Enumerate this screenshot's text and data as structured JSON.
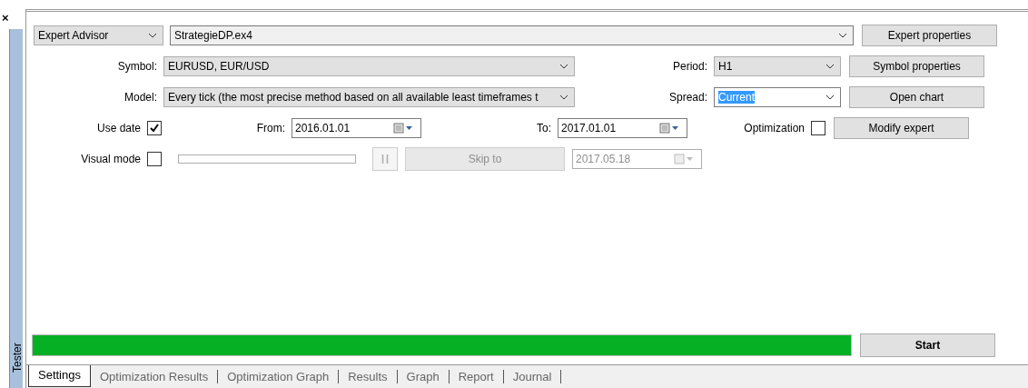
{
  "close": "×",
  "side_label": "Tester",
  "expert": {
    "type": "Expert Advisor",
    "file": "StrategieDP.ex4"
  },
  "symbol": {
    "label": "Symbol:",
    "value": "EURUSD, EUR/USD"
  },
  "period": {
    "label": "Period:",
    "value": "H1"
  },
  "model": {
    "label": "Model:",
    "value": "Every tick (the most precise method based on all available least timeframes t"
  },
  "spread": {
    "label": "Spread:",
    "value": "Current",
    "selected": true
  },
  "use_date": {
    "label": "Use date",
    "checked": true
  },
  "from": {
    "label": "From:",
    "value": "2016.01.01"
  },
  "to": {
    "label": "To:",
    "value": "2017.01.01"
  },
  "optimization": {
    "label": "Optimization",
    "checked": false
  },
  "visual_mode": {
    "label": "Visual mode",
    "checked": false
  },
  "pause": {
    "disabled": true
  },
  "skip_to": {
    "label": "Skip to",
    "disabled": true
  },
  "skip_date": {
    "value": "2017.05.18",
    "disabled": true
  },
  "buttons": [
    "Expert properties",
    "Symbol properties",
    "Open chart",
    "Modify expert"
  ],
  "progress": {
    "level": 1
  },
  "start": "Start",
  "tabs": [
    {
      "label": "Settings",
      "selected": true
    },
    {
      "label": "Optimization Results",
      "selected": false
    },
    {
      "label": "Optimization Graph",
      "selected": false
    },
    {
      "label": "Results",
      "selected": false
    },
    {
      "label": "Graph",
      "selected": false
    },
    {
      "label": "Report",
      "selected": false
    },
    {
      "label": "Journal",
      "selected": false
    }
  ]
}
